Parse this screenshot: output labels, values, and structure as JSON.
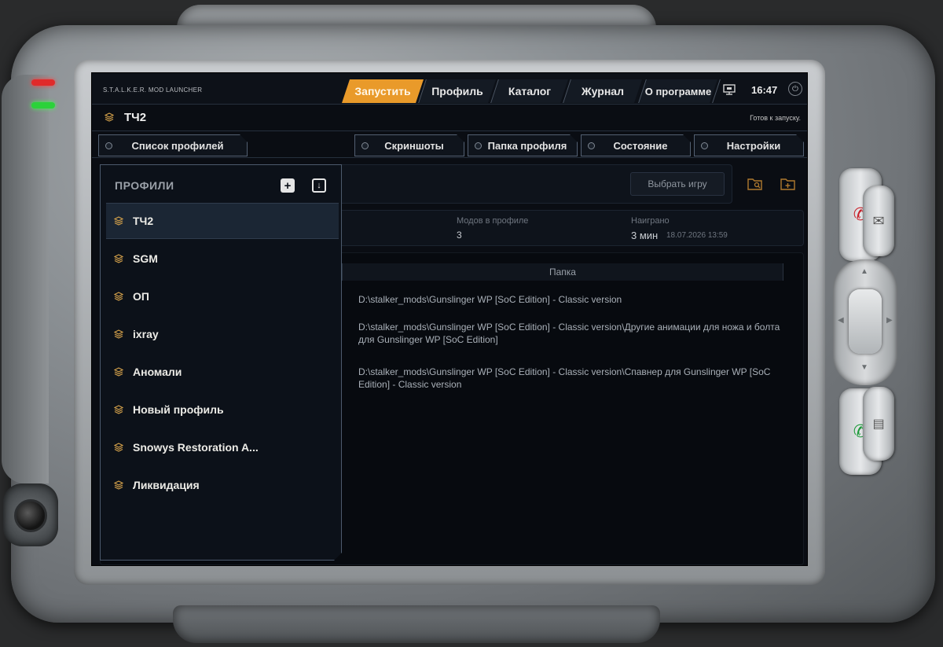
{
  "app": {
    "title": "S.T.A.L.K.E.R. MOD LAUNCHER",
    "clock": "16:47"
  },
  "nav": {
    "tabs": [
      {
        "label": "Запустить",
        "active": true
      },
      {
        "label": "Профиль",
        "active": false
      },
      {
        "label": "Каталог",
        "active": false
      },
      {
        "label": "Журнал",
        "active": false
      },
      {
        "label": "О программе",
        "active": false
      }
    ]
  },
  "profile": {
    "name": "ТЧ2",
    "status": "Готов к запуску."
  },
  "subtabs": [
    {
      "label": "Список профилей"
    },
    {
      "label": "Скриншоты"
    },
    {
      "label": "Папка профиля"
    },
    {
      "label": "Состояние"
    },
    {
      "label": "Настройки"
    }
  ],
  "game": {
    "select_button": "Выбрать игру"
  },
  "stats": {
    "mods_label": "Модов в профиле",
    "mods_value": "3",
    "played_label": "Наиграно",
    "played_value": "3 мин",
    "played_date": "18.07.2026 13:59"
  },
  "mods_table": {
    "folder_header": "Папка",
    "rows": [
      "D:\\stalker_mods\\Gunslinger WP [SoC Edition] - Classic version",
      "D:\\stalker_mods\\Gunslinger WP [SoC Edition] - Classic version\\Другие анимации для ножа и болта для Gunslinger WP [SoC Edition]",
      "D:\\stalker_mods\\Gunslinger WP [SoC Edition] - Classic version\\Спавнер для Gunslinger WP [SoC Edition] - Classic version"
    ]
  },
  "profiles_panel": {
    "title": "ПРОФИЛИ",
    "items": [
      {
        "label": "ТЧ2",
        "selected": true
      },
      {
        "label": "SGM",
        "selected": false
      },
      {
        "label": "ОП",
        "selected": false
      },
      {
        "label": "ixray",
        "selected": false
      },
      {
        "label": "Аномали",
        "selected": false
      },
      {
        "label": "Новый профиль",
        "selected": false
      },
      {
        "label": "Snowys Restoration A...",
        "selected": false
      },
      {
        "label": "Ликвидация",
        "selected": false
      }
    ]
  },
  "colors": {
    "accent": "#e99a2a",
    "icon_gold": "#d3a04a",
    "screen_bg": "#0a0d13"
  }
}
